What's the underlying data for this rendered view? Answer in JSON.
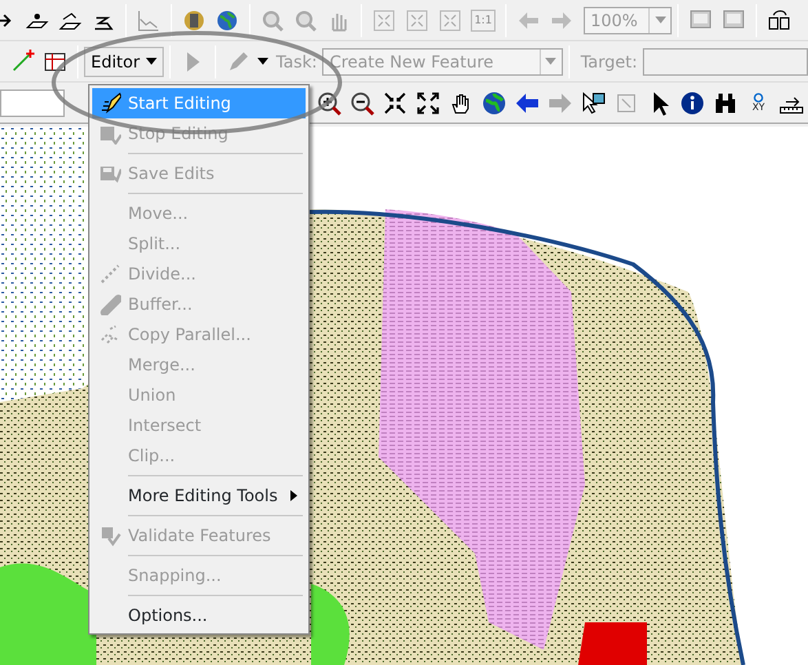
{
  "toolbar_top": {
    "zoom_combo": {
      "value": "100%",
      "disabled": true
    },
    "scale_button": "1:1"
  },
  "editor_toolbar": {
    "editor_button": "Editor",
    "task_label": "Task:",
    "task_combo": {
      "value": "Create New Feature",
      "disabled": true
    },
    "target_label": "Target:",
    "target_field": {
      "disabled": true
    }
  },
  "tools_toolbar": {
    "xy_label": "XY"
  },
  "editor_menu": {
    "items": [
      {
        "kind": "item",
        "label": "Start Editing",
        "disabled": false,
        "selected": true
      },
      {
        "kind": "item",
        "label": "Stop Editing",
        "disabled": true,
        "selected": false
      },
      {
        "kind": "separator"
      },
      {
        "kind": "item",
        "label": "Save Edits",
        "disabled": true,
        "selected": false
      },
      {
        "kind": "separator"
      },
      {
        "kind": "item",
        "label": "Move...",
        "disabled": true,
        "selected": false
      },
      {
        "kind": "item",
        "label": "Split...",
        "disabled": true,
        "selected": false
      },
      {
        "kind": "item",
        "label": "Divide...",
        "disabled": true,
        "selected": false
      },
      {
        "kind": "item",
        "label": "Buffer...",
        "disabled": true,
        "selected": false
      },
      {
        "kind": "item",
        "label": "Copy Parallel...",
        "disabled": true,
        "selected": false
      },
      {
        "kind": "item",
        "label": "Merge...",
        "disabled": true,
        "selected": false
      },
      {
        "kind": "item",
        "label": "Union",
        "disabled": true,
        "selected": false
      },
      {
        "kind": "item",
        "label": "Intersect",
        "disabled": true,
        "selected": false
      },
      {
        "kind": "item",
        "label": "Clip...",
        "disabled": true,
        "selected": false
      },
      {
        "kind": "separator"
      },
      {
        "kind": "submenu",
        "label": "More Editing Tools",
        "disabled": false,
        "selected": false
      },
      {
        "kind": "separator"
      },
      {
        "kind": "item",
        "label": "Validate Features",
        "disabled": true,
        "selected": false
      },
      {
        "kind": "separator"
      },
      {
        "kind": "item",
        "label": "Snapping...",
        "disabled": true,
        "selected": false
      },
      {
        "kind": "separator"
      },
      {
        "kind": "item",
        "label": "Options...",
        "disabled": false,
        "selected": false
      }
    ]
  }
}
